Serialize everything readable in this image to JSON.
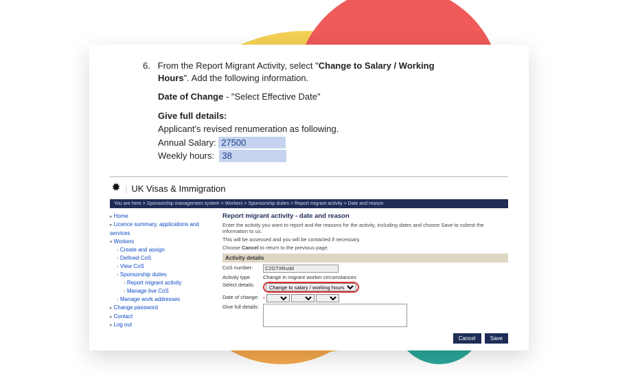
{
  "instruction": {
    "number": "6.",
    "line1a": "From the Report Migrant Activity, select \"",
    "line1b": "Change to Salary / Working Hours",
    "line1c": "\". Add the following information.",
    "doc_label": "Date of Change",
    "doc_value": " - \"Select Effective Date\"",
    "gfd": "Give full details:",
    "renum": "Applicant's revised renumeration as following.",
    "salary_label": "Annual Salary:",
    "salary_value": "27500",
    "hours_label": "Weekly hours:",
    "hours_value": "38"
  },
  "gov": {
    "brand": "UK Visas & Immigration",
    "breadcrumb": "You are here > Sponsorship management system > Workers > Sponsorship duties > Report migrant activity > Date and reason",
    "sidebar": [
      {
        "label": "Home",
        "cls": "lvl1"
      },
      {
        "label": "Licence summary, applications and services",
        "cls": "lvl1"
      },
      {
        "label": "Workers",
        "cls": "lvl1 open"
      },
      {
        "label": "Create and assign",
        "cls": "lvl2"
      },
      {
        "label": "Defined CoS",
        "cls": "lvl2"
      },
      {
        "label": "View CoS",
        "cls": "lvl2"
      },
      {
        "label": "Sponsorship duties",
        "cls": "lvl2"
      },
      {
        "label": "Report migrant activity",
        "cls": "lvl2",
        "indent": true
      },
      {
        "label": "Manage live CoS",
        "cls": "lvl2",
        "indent": true
      },
      {
        "label": "Manage work addresses",
        "cls": "lvl2"
      },
      {
        "label": "Change password",
        "cls": "lvl1"
      },
      {
        "label": "Contact",
        "cls": "lvl1"
      },
      {
        "label": "Log out",
        "cls": "lvl1"
      }
    ],
    "title": "Report migrant activity - date and reason",
    "p1": "Enter the activity you want to report and the reasons for the activity, including dates and choose Save to submit the information to us.",
    "p2": "This will be assessed and you will be contacted if necessary.",
    "p3a": "Choose ",
    "p3b": "Cancel",
    "p3c": " to return to the previous page.",
    "section": "Activity details",
    "rows": {
      "cos_label": "CoS number:",
      "cos_value": "C2GT#Rudd",
      "act_label": "Activity type",
      "act_value": "Change in migrant worker circumstances",
      "sel_label": "Select details:",
      "sel_value": "Change to salary / working hours",
      "date_label": "Date of change:",
      "date_star": "*",
      "details_label": "Give full details:"
    },
    "cancel": "Cancel",
    "save": "Save"
  }
}
